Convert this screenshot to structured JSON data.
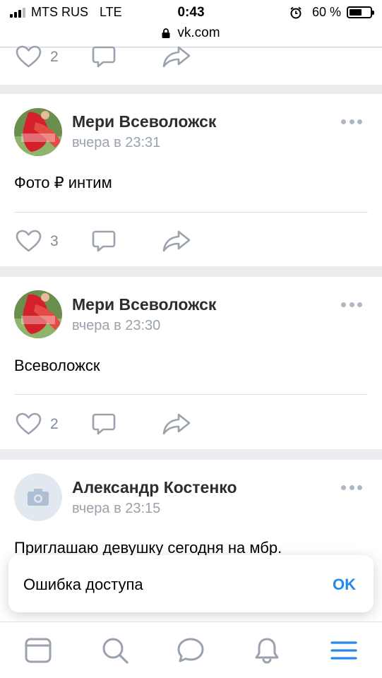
{
  "status_bar": {
    "carrier": "MTS RUS",
    "network": "LTE",
    "time": "0:43",
    "battery_percent": "60 %",
    "battery_level": 0.6
  },
  "url_bar": {
    "domain": "vk.com"
  },
  "top_post_actions": {
    "likes": "2"
  },
  "posts": [
    {
      "author": "Мери Всеволожск",
      "time": "вчера в 23:31",
      "text": "Фото ₽ интим",
      "likes": "3"
    },
    {
      "author": "Мери Всеволожск",
      "time": "вчера в 23:30",
      "text": "Всеволожск",
      "likes": "2"
    },
    {
      "author": "Александр Костенко",
      "time": "вчера в 23:15",
      "text": "Приглашаю девушку сегодня на мбр."
    }
  ],
  "toast": {
    "message": "Ошибка доступа",
    "ok_label": "OK"
  },
  "tab_bar": {
    "items": [
      "feed-icon",
      "search-icon",
      "messages-icon",
      "notifications-icon",
      "menu-icon"
    ]
  },
  "colors": {
    "accent": "#2688eb",
    "icon_gray": "#99a2ad",
    "background": "#ebedf0"
  }
}
